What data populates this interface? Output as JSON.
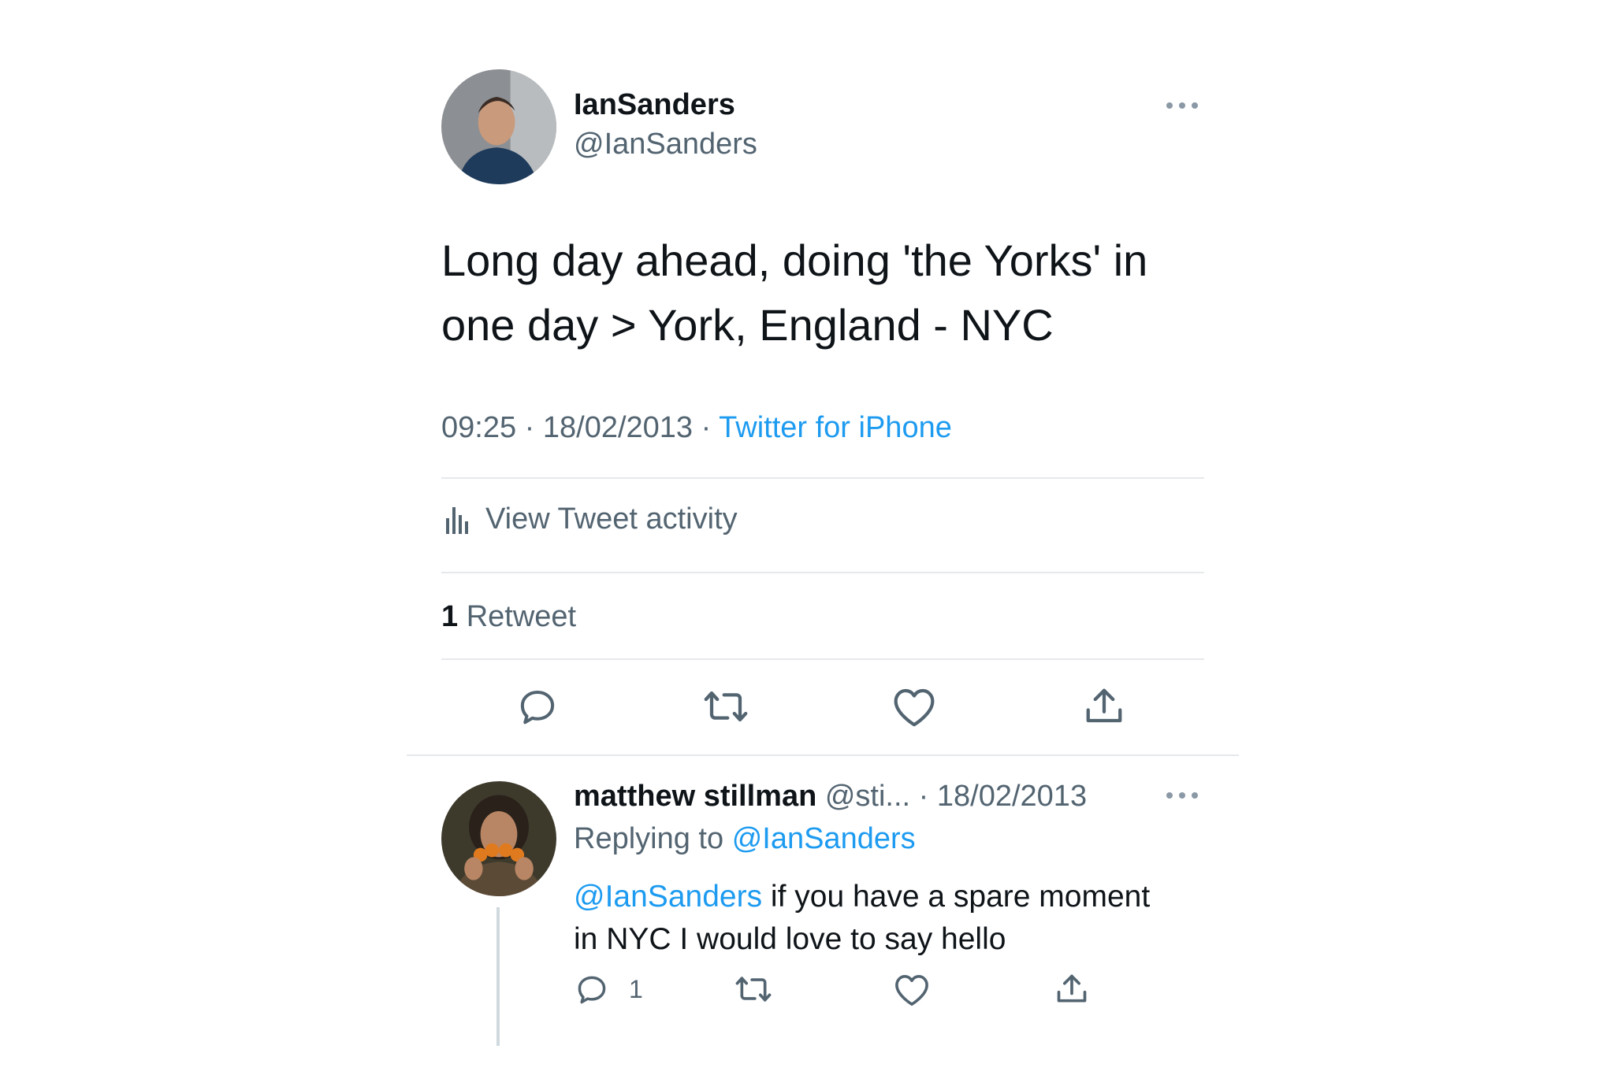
{
  "tweet": {
    "display_name": "IanSanders",
    "handle": "@IanSanders",
    "text": "Long day ahead, doing 'the Yorks' in one day > York, England - NYC",
    "time": "09:25",
    "sep1": "·",
    "date": "18/02/2013",
    "sep2": "·",
    "source": "Twitter for iPhone",
    "activity_label": "View Tweet activity",
    "retweet_count": "1",
    "retweet_label": "Retweet",
    "icons": [
      "reply-icon",
      "retweet-icon",
      "like-icon",
      "share-icon"
    ]
  },
  "reply": {
    "display_name": "matthew stillman",
    "handle": "@sti...",
    "sep": "·",
    "date": "18/02/2013",
    "replying_prefix": "Replying to",
    "replying_to": "@IanSanders",
    "mention": "@IanSanders",
    "text_line1": " if you have a spare moment",
    "text_line2": "in NYC I would love to say hello",
    "reply_count": "1",
    "icons": [
      "reply-icon",
      "retweet-icon",
      "like-icon",
      "share-icon"
    ]
  },
  "colors": {
    "accent": "#1d9bf0",
    "muted": "#536471",
    "text": "#0f1419",
    "divider": "#e6e9ec"
  }
}
